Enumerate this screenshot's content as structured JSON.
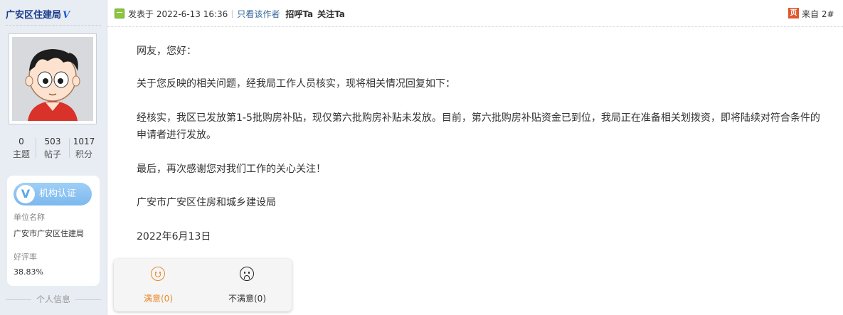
{
  "user": {
    "name": "广安区住建局",
    "verified_mark": "V",
    "stats": [
      {
        "value": "0",
        "label": "主题"
      },
      {
        "value": "503",
        "label": "帖子"
      },
      {
        "value": "1017",
        "label": "积分"
      }
    ],
    "certification": {
      "button_label": "机构认证",
      "logo_letter": "V",
      "unit_label": "单位名称",
      "unit_value": "广安市广安区住建局",
      "rating_label": "好评率",
      "rating_value": "38.83%"
    },
    "personal_info_label": "个人信息"
  },
  "post": {
    "time": "发表于 2022-6-13 16:36",
    "only_author": "只看该作者",
    "greet": "招呼Ta",
    "follow": "关注Ta",
    "source_icon_text": "页",
    "floor_info": "来自 2#",
    "paragraphs": [
      "网友，您好：",
      "关于您反映的相关问题，经我局工作人员核实，现将相关情况回复如下：",
      "经核实，我区已发放第1-5批购房补贴，现仅第六批购房补贴未发放。目前，第六批购房补贴资金已到位，我局正在准备相关划拨资，即将陆续对符合条件的申请者进行发放。",
      "最后，再次感谢您对我们工作的关心关注！",
      "广安市广安区住房和城乡建设局",
      "2022年6月13日"
    ]
  },
  "rating": {
    "satisfied": "满意(0)",
    "unsatisfied": "不满意(0)"
  },
  "colors": {
    "sidebar_bg": "#e8edf3",
    "link": "#336699",
    "accent_orange": "#e88a2e",
    "cert_blue": "#7cb8ee",
    "source_red": "#e2572f",
    "online_green": "#8cc63f"
  }
}
